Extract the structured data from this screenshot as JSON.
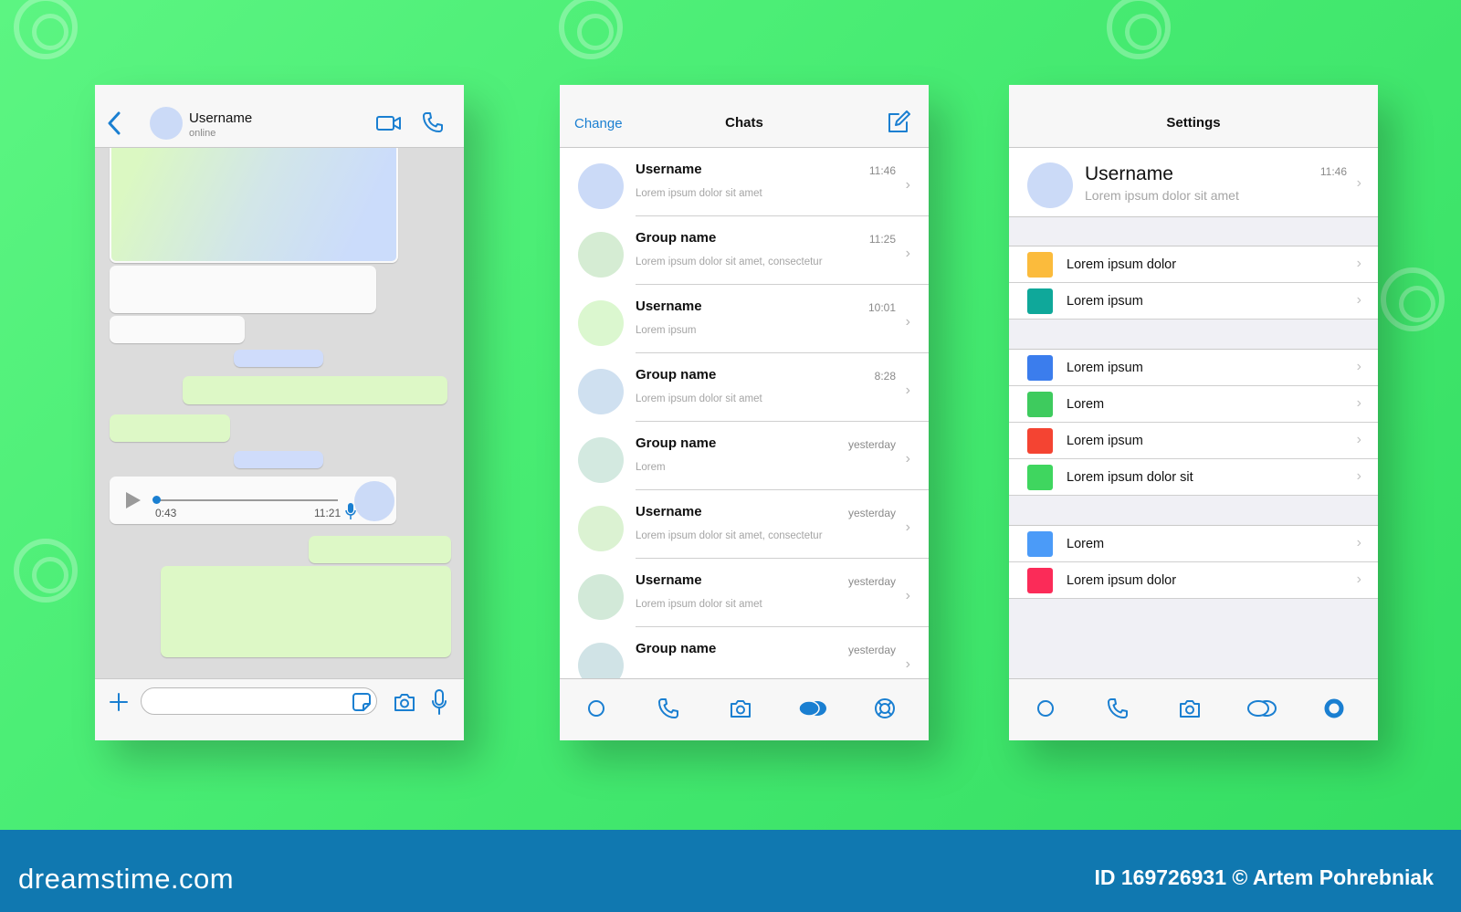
{
  "chat_screen": {
    "contact_name": "Username",
    "contact_status": "online",
    "voice_message": {
      "duration": "0:43",
      "time": "11:21",
      "progress": 0.0
    },
    "input": {
      "value": "",
      "placeholder": ""
    }
  },
  "chats_screen": {
    "edit_label": "Change",
    "title": "Chats",
    "chats": [
      {
        "name": "Username",
        "preview": "Lorem ipsum dolor sit amet",
        "time": "11:46",
        "avatar_color": "#cbdaf7"
      },
      {
        "name": "Group name",
        "preview": "Lorem ipsum dolor sit amet, consectetur",
        "time": "11:25",
        "avatar_color": "#d5ecd3"
      },
      {
        "name": "Username",
        "preview": "Lorem ipsum",
        "time": "10:01",
        "avatar_color": "#dbf7cf"
      },
      {
        "name": "Group name",
        "preview": "Lorem ipsum dolor sit amet",
        "time": "8:28",
        "avatar_color": "#cfe0f0"
      },
      {
        "name": "Group name",
        "preview": "Lorem",
        "time": "yesterday",
        "avatar_color": "#d3e9e0"
      },
      {
        "name": "Username",
        "preview": "Lorem ipsum dolor sit amet, consectetur",
        "time": "yesterday",
        "avatar_color": "#dbf2d2"
      },
      {
        "name": "Username",
        "preview": "Lorem ipsum dolor sit amet",
        "time": "yesterday",
        "avatar_color": "#d2e9d8"
      },
      {
        "name": "Group name",
        "preview": "",
        "time": "yesterday",
        "avatar_color": "#d0e3e6"
      }
    ],
    "active_tab": 3
  },
  "settings_screen": {
    "title": "Settings",
    "profile": {
      "name": "Username",
      "status": "Lorem ipsum dolor sit amet",
      "time": "11:46"
    },
    "groups": [
      [
        {
          "label": "Lorem ipsum dolor",
          "color": "#fbbb3c"
        },
        {
          "label": "Lorem ipsum",
          "color": "#0fa89a"
        }
      ],
      [
        {
          "label": "Lorem ipsum",
          "color": "#3b7ded"
        },
        {
          "label": "Lorem",
          "color": "#3ecb5e"
        },
        {
          "label": "Lorem ipsum",
          "color": "#f44432"
        },
        {
          "label": "Lorem ipsum dolor sit",
          "color": "#3fd65f"
        }
      ],
      [
        {
          "label": "Lorem",
          "color": "#4b9bf8"
        },
        {
          "label": "Lorem ipsum dolor",
          "color": "#fb2b58"
        }
      ]
    ],
    "active_tab": 4
  },
  "tabs": [
    {
      "icon": "status-circle-icon"
    },
    {
      "icon": "phone-icon"
    },
    {
      "icon": "camera-icon"
    },
    {
      "icon": "chats-bubbles-icon"
    },
    {
      "icon": "settings-lifebuoy-icon"
    }
  ],
  "footer": {
    "brand": "dreamstime.com",
    "credit": "ID 169726931 © Artem Pohrebniak"
  },
  "colors": {
    "accent": "#1a7fd1",
    "background_green": "#48ec73",
    "footer_blue": "#1078b0",
    "bubble_green": "#ddf8c6",
    "bubble_blue": "#cfdcfb"
  }
}
